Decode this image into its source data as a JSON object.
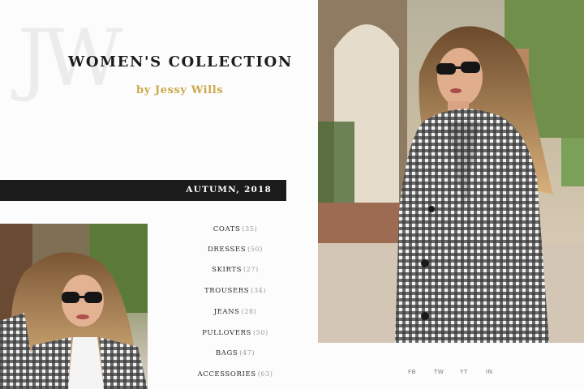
{
  "brand": {
    "monogram": "JW",
    "title": "WOMEN'S COLLECTION",
    "byline": "by Jessy Wills"
  },
  "season": {
    "label": "AUTUMN, 2018"
  },
  "categories": [
    {
      "label": "COATS",
      "count": "(35)"
    },
    {
      "label": "DRESSES",
      "count": "(50)"
    },
    {
      "label": "SKIRTS",
      "count": "(27)"
    },
    {
      "label": "TROUSERS",
      "count": "(34)"
    },
    {
      "label": "JEANS",
      "count": "(28)"
    },
    {
      "label": "PULLOVERS",
      "count": "(50)"
    },
    {
      "label": "BAGS",
      "count": "(47)"
    },
    {
      "label": "ACCESSORIES",
      "count": "(63)"
    }
  ],
  "social": [
    "FB",
    "TW",
    "YT",
    "IN"
  ],
  "colors": {
    "accent": "#c9a94a",
    "bar": "#1b1b1b",
    "background": "#fdfcfc"
  }
}
